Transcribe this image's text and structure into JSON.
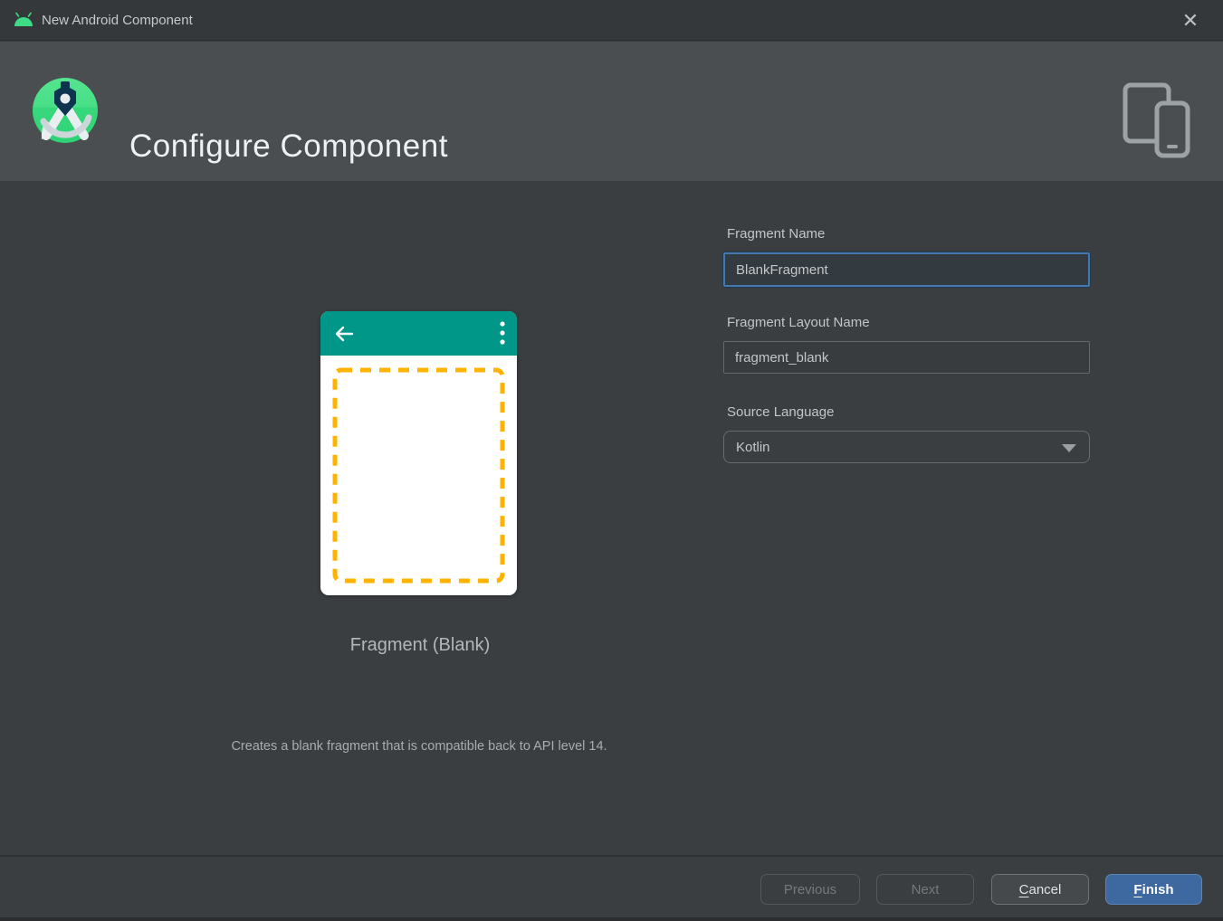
{
  "window": {
    "title": "New Android Component"
  },
  "header": {
    "title": "Configure Component"
  },
  "preview": {
    "card_label": "Fragment (Blank)",
    "description": "Creates a blank fragment that is compatible back to API level 14."
  },
  "form": {
    "fragment_name": {
      "label": "Fragment Name",
      "value": "BlankFragment"
    },
    "fragment_layout_name": {
      "label": "Fragment Layout Name",
      "value": "fragment_blank"
    },
    "source_language": {
      "label": "Source Language",
      "value": "Kotlin"
    }
  },
  "footer": {
    "previous_label": "Previous",
    "next_label": "Next",
    "cancel_mnemonic": "C",
    "cancel_rest": "ancel",
    "finish_mnemonic": "F",
    "finish_rest": "inish"
  },
  "icons": {
    "close": "✕",
    "android-head-icon": "android robot head, green",
    "android-studio-logo": "green circle with dark compass",
    "devices-icon": "tablet and phone outline",
    "back-arrow-icon": "left arrow, white",
    "overflow-menu-icon": "three vertical dots, white",
    "dropdown-arrow-icon": "down triangle, gray"
  },
  "colors": {
    "toolbar_teal": "#009688",
    "dashed_amber": "#FFB300",
    "focus_border_blue": "#4478AE",
    "finish_button_blue": "#3E68A0",
    "android_green": "#3DDC84",
    "header_bg": "#4A4E50",
    "main_bg": "#3B3E41",
    "titlebar_bg": "#35383A"
  }
}
